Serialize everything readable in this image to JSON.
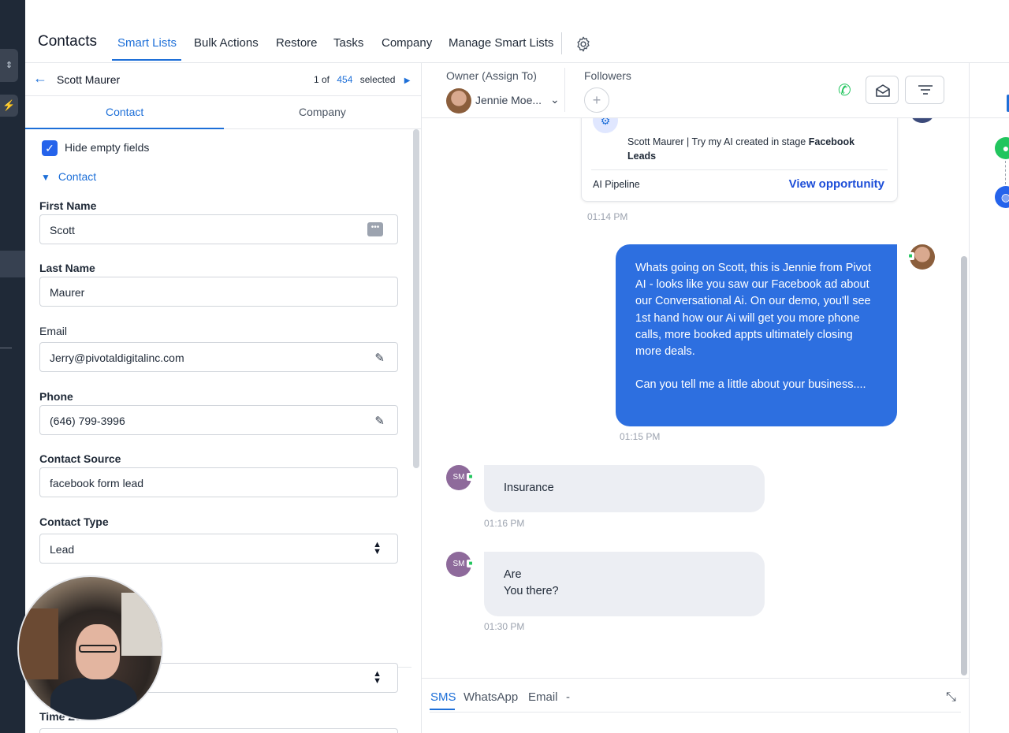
{
  "topnav": {
    "title": "Contacts",
    "items": [
      "Smart Lists",
      "Bulk Actions",
      "Restore",
      "Tasks",
      "Company",
      "Manage Smart Lists"
    ]
  },
  "contact_header": {
    "name": "Scott Maurer",
    "pager_prefix": "1 of",
    "pager_total": "454",
    "pager_suffix": "selected"
  },
  "detail_tabs": [
    "Contact",
    "Company"
  ],
  "form": {
    "hide_empty_label": "Hide empty fields",
    "hide_empty_checked": true,
    "section_label": "Contact",
    "fields": [
      {
        "label": "First Name",
        "value": "Scott"
      },
      {
        "label": "Last Name",
        "value": "Maurer"
      },
      {
        "label": "Email",
        "value": "Jerry@pivotaldigitalinc.com"
      },
      {
        "label": "Phone",
        "value": "(646) 799-3996"
      },
      {
        "label": "Contact Source",
        "value": "facebook form lead"
      },
      {
        "label": "Contact Type",
        "value": "Lead"
      }
    ],
    "partial_label": "Time Zone"
  },
  "conversation_header": {
    "owner_label": "Owner (Assign To)",
    "owner_name": "Jennie Moe...",
    "followers_label": "Followers"
  },
  "messages": {
    "opportunity": {
      "text_prefix": "Scott Maurer | Try my AI created in stage ",
      "stage": "Facebook Leads",
      "pipeline": "AI Pipeline",
      "link": "View opportunity",
      "time": "01:14 PM"
    },
    "outbound": {
      "text": "Whats going on Scott, this is Jennie from Pivot AI - looks like you saw our Facebook ad about our Conversational Ai. On our demo, you'll see 1st hand how our Ai will get you more phone calls, more booked appts ultimately closing more deals.\n\nCan you tell me a little about your business....",
      "time": "01:15 PM"
    },
    "inbound": [
      {
        "initials": "SM",
        "text": "Insurance",
        "time": "01:16 PM"
      },
      {
        "initials": "SM",
        "text": "Are\nYou there?",
        "time": "01:30 PM"
      }
    ]
  },
  "composer": {
    "tabs": [
      "SMS",
      "WhatsApp",
      "Email",
      "-"
    ]
  },
  "colors": {
    "accent": "#1d6fd8",
    "outbound_bubble": "#2d6fe0",
    "inbound_bubble": "#eceef3",
    "sidebar": "#1f2937",
    "call": "#22c55e"
  }
}
